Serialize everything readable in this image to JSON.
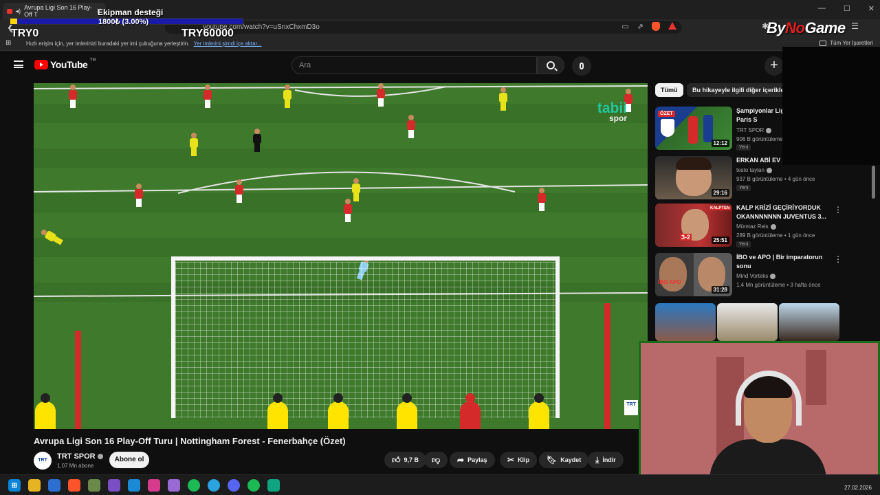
{
  "browser": {
    "tab_title": "Avrupa Ligi Son 16 Play-Off T",
    "url": "youtube.com/watch?v=uSnxChxmD3o",
    "bookmark_hint": "Hızlı erişim için, yer imlerinizi buradaki yer imi çubuğuna yerleştirin.",
    "bookmark_link": "Yer imlerini şimdi içe aktar...",
    "all_bookmarks": "Tüm Yer İşaretleri"
  },
  "overlay": {
    "equipment_title": "Ekipman desteği",
    "equipment_amount": "1800₺ (3.00%)",
    "equipment_progress": 0.03,
    "goal_min": "TRY0",
    "goal_max": "TRY60000",
    "streamer_logo_a": "By",
    "streamer_logo_b": "No",
    "streamer_logo_c": "Game"
  },
  "youtube": {
    "logo_text": "YouTube",
    "logo_region": "TR",
    "search_placeholder": "Ara"
  },
  "video": {
    "watermark": "tabii",
    "watermark_sub": "spor",
    "corner_badge": "TRT",
    "title": "Avrupa Ligi Son 16 Play-Off Turu | Nottingham Forest - Fenerbahçe (Özet)",
    "channel": "TRT SPOR",
    "channel_avatar": "TRT",
    "subscribers": "1,07 Mn abone",
    "subscribe_label": "Abone ol",
    "likes": "9,7 B",
    "share_label": "Paylaş",
    "clip_label": "Klip",
    "save_label": "Kaydet",
    "download_label": "İndir"
  },
  "sidebar": {
    "chips": [
      "Tümü",
      "Bu hikayeyle ilgili diğer içerikler"
    ],
    "recommendations": [
      {
        "title": "Şampiyonlar Ligi Play-Off Turu | Paris S",
        "channel": "TRT SPOR",
        "meta": "906 B görüntüleme",
        "badge": "Yeni",
        "duration": "12:12"
      },
      {
        "title": "ERKAN ABİ EV Z",
        "channel": "testo taylan",
        "meta": "937 B görüntüleme • 4 gün önce",
        "badge": "Yeni",
        "duration": "29:16"
      },
      {
        "title": "KALP KRİZİ GEÇİRİYORDUK OKANNNNNNN JUVENTUS 3...",
        "channel": "Mümtaz Reis",
        "meta": "289 B görüntüleme • 1 gün önce",
        "badge": "Yeni",
        "duration": "25:51"
      },
      {
        "title": "İBO ve APO | Bir imparatorun sonu",
        "channel": "Mind Vorteks",
        "meta": "1,4 Mn görüntüleme • 3 hafta önce",
        "badge": "",
        "duration": "31:28"
      }
    ],
    "thumb_texts": {
      "rec0": "ÖZET",
      "rec2a": "3-2",
      "rec2b": "KALPTEN",
      "rec3": "İBO APO"
    }
  },
  "taskbar": {
    "date": "27.02.2026",
    "apps": [
      "start-icon",
      "file-explorer-icon",
      "store-icon",
      "brave-icon",
      "puzzle-icon",
      "visual-studio-icon",
      "vscode-icon",
      "instagram-icon",
      "feather-icon",
      "spotify-icon",
      "telegram-icon",
      "discord-icon",
      "spotify-alt-icon",
      "chatbot-icon"
    ]
  }
}
